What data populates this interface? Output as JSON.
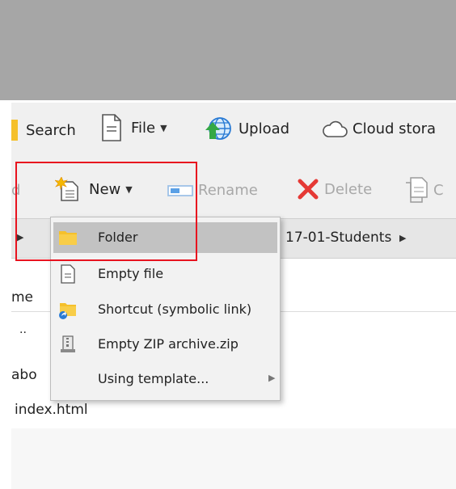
{
  "toolbar_top": {
    "search_label": "Search",
    "file_label": "File",
    "upload_label": "Upload",
    "cloud_label": "Cloud stora"
  },
  "toolbar_second": {
    "cut_label_partial": "d",
    "new_label": "New",
    "rename_label": "Rename",
    "delete_label": "Delete",
    "next_label_partial": "C"
  },
  "new_menu": {
    "items": [
      {
        "label": "Folder",
        "icon": "folder-icon",
        "active": true
      },
      {
        "label": "Empty file",
        "icon": "file-icon"
      },
      {
        "label": "Shortcut (symbolic link)",
        "icon": "shortcut-icon"
      },
      {
        "label": "Empty ZIP archive.zip",
        "icon": "zip-archive-icon"
      },
      {
        "label": "Using template...",
        "icon": "",
        "submenu": true
      }
    ]
  },
  "path": {
    "current_folder": "17-01-Students"
  },
  "columns": {
    "name_partial": "me"
  },
  "files": [
    {
      "name": ".."
    },
    {
      "name": "abo"
    },
    {
      "name": "index.html"
    }
  ],
  "colors": {
    "highlight": "#e8131f",
    "menu_active": "#c2c2c2",
    "delete_red": "#e53935",
    "folder_yellow": "#f5c02b",
    "upload_blue": "#2a7bd4",
    "upload_green": "#34a845"
  }
}
